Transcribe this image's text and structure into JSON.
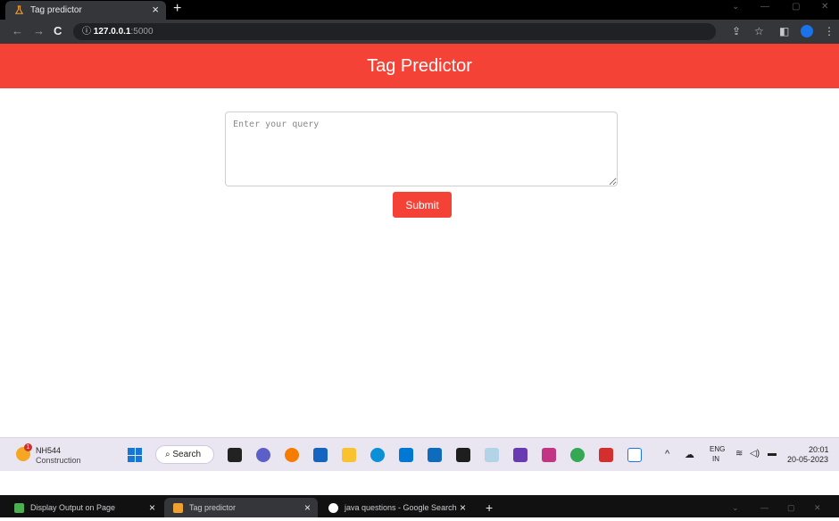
{
  "browser": {
    "tab_title": "Tag predictor",
    "url_host": "127.0.0.1",
    "url_port": ":5000"
  },
  "app": {
    "title": "Tag Predictor",
    "query_placeholder": "Enter your query",
    "submit_label": "Submit",
    "accent_color": "#f44336"
  },
  "taskbar": {
    "weather_badge": "1",
    "weather_line1": "NH544",
    "weather_line2": "Construction",
    "search_label": "Search",
    "lang_line1": "ENG",
    "lang_line2": "IN",
    "time": "20:01",
    "date": "20-05-2023"
  },
  "bottom_tabs": [
    {
      "label": "Display Output on Page"
    },
    {
      "label": "Tag predictor"
    },
    {
      "label": "java questions - Google Search"
    }
  ]
}
